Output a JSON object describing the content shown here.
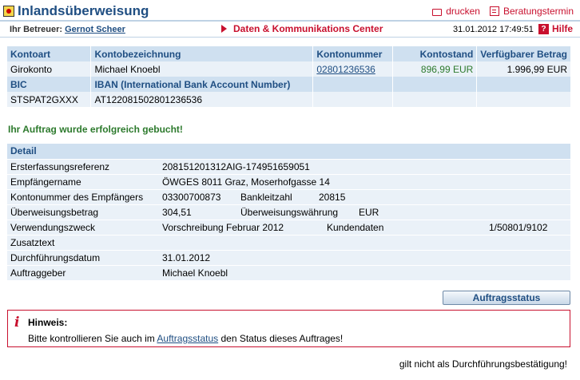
{
  "title": "Inlandsüberweisung",
  "top_actions": {
    "print": "drucken",
    "appointment": "Beratungstermin"
  },
  "subbar": {
    "advisor_label": "Ihr Betreuer:",
    "advisor_name": "Gernot Scheer",
    "center_link": "Daten & Kommunikations Center",
    "datetime": "31.01.2012 17:49:51",
    "help": "Hilfe",
    "help_icon": "?"
  },
  "account": {
    "headers": [
      "Kontoart",
      "Kontobezeichnung",
      "Kontonummer",
      "Kontostand",
      "Verfügbarer Betrag"
    ],
    "row": [
      "Girokonto",
      "Michael Knoebl",
      "02801236536",
      "896,99 EUR",
      "1.996,99 EUR"
    ],
    "headers2": [
      "BIC",
      "IBAN (International Bank Account Number)"
    ],
    "row2": [
      "STSPAT2GXXX",
      "AT122081502801236536"
    ]
  },
  "success_message": "Ihr Auftrag wurde erfolgreich gebucht!",
  "detail": {
    "header": "Detail",
    "rows": {
      "ref_label": "Ersterfassungsreferenz",
      "ref_value": "208151201312AIG-174951659051",
      "recipient_label": "Empfängername",
      "recipient_value": "ÖWGES 8011 Graz, Moserhofgasse 14",
      "accno_label": "Kontonummer des Empfängers",
      "accno_value": "03300700873",
      "blz_label": "Bankleitzahl",
      "blz_value": "20815",
      "amount_label": "Überweisungsbetrag",
      "amount_value": "304,51",
      "currency_label": "Überweisungswährung",
      "currency_value": "EUR",
      "purpose_label": "Verwendungszweck",
      "purpose_value": "Vorschreibung Februar 2012",
      "customer_label": "Kundendaten",
      "customer_value": "1/50801/9102",
      "extra_label": "Zusatztext",
      "extra_value": "",
      "date_label": "Durchführungsdatum",
      "date_value": "31.01.2012",
      "orderer_label": "Auftraggeber",
      "orderer_value": "Michael Knoebl"
    }
  },
  "status_button": "Auftragsstatus",
  "notice": {
    "icon": "i",
    "title": "Hinweis:",
    "text_before": "Bitte kontrollieren Sie auch im",
    "link": "Auftragsstatus",
    "text_after": "den Status dieses Auftrages!"
  },
  "footnote": "gilt nicht als Durchführungsbestätigung!",
  "colors": {
    "brand_blue": "#1f4e82",
    "accent_red": "#c8102e",
    "success_green": "#2d7a2d",
    "row_bg": "#eaf1f8",
    "header_bg": "#cfe0f0"
  }
}
